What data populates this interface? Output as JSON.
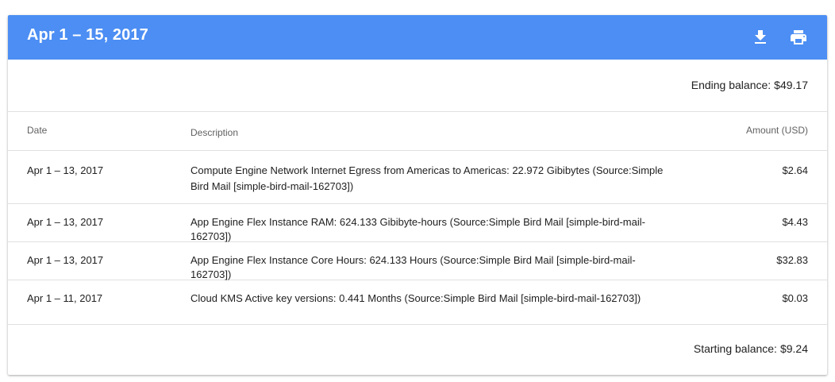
{
  "header": {
    "title": "Apr 1 – 15, 2017",
    "bg_color": "#4c8ef3",
    "icons": [
      "download-icon",
      "print-icon"
    ]
  },
  "ending_balance": {
    "label": "Ending balance:",
    "value": "$49.17"
  },
  "table": {
    "columns": [
      "Date",
      "Description",
      "Amount (USD)"
    ],
    "rows": [
      {
        "date": "Apr 1 – 13, 2017",
        "description": "Compute Engine Network Internet Egress from Americas to Americas: 22.972 Gibibytes (Source:Simple Bird Mail [simple-bird-mail-162703])",
        "amount": "$2.64"
      },
      {
        "date": "Apr 1 – 13, 2017",
        "description": "App Engine Flex Instance RAM: 624.133 Gibibyte-hours (Source:Simple Bird Mail [simple-bird-mail-162703])",
        "amount": "$4.43"
      },
      {
        "date": "Apr 1 – 13, 2017",
        "description": "App Engine Flex Instance Core Hours: 624.133 Hours (Source:Simple Bird Mail [simple-bird-mail-162703])",
        "amount": "$32.83"
      },
      {
        "date": "Apr 1 – 11, 2017",
        "description": "Cloud KMS Active key versions: 0.441 Months (Source:Simple Bird Mail [simple-bird-mail-162703])",
        "amount": "$0.03"
      }
    ]
  },
  "starting_balance": {
    "label": "Starting balance:",
    "value": "$9.24"
  }
}
